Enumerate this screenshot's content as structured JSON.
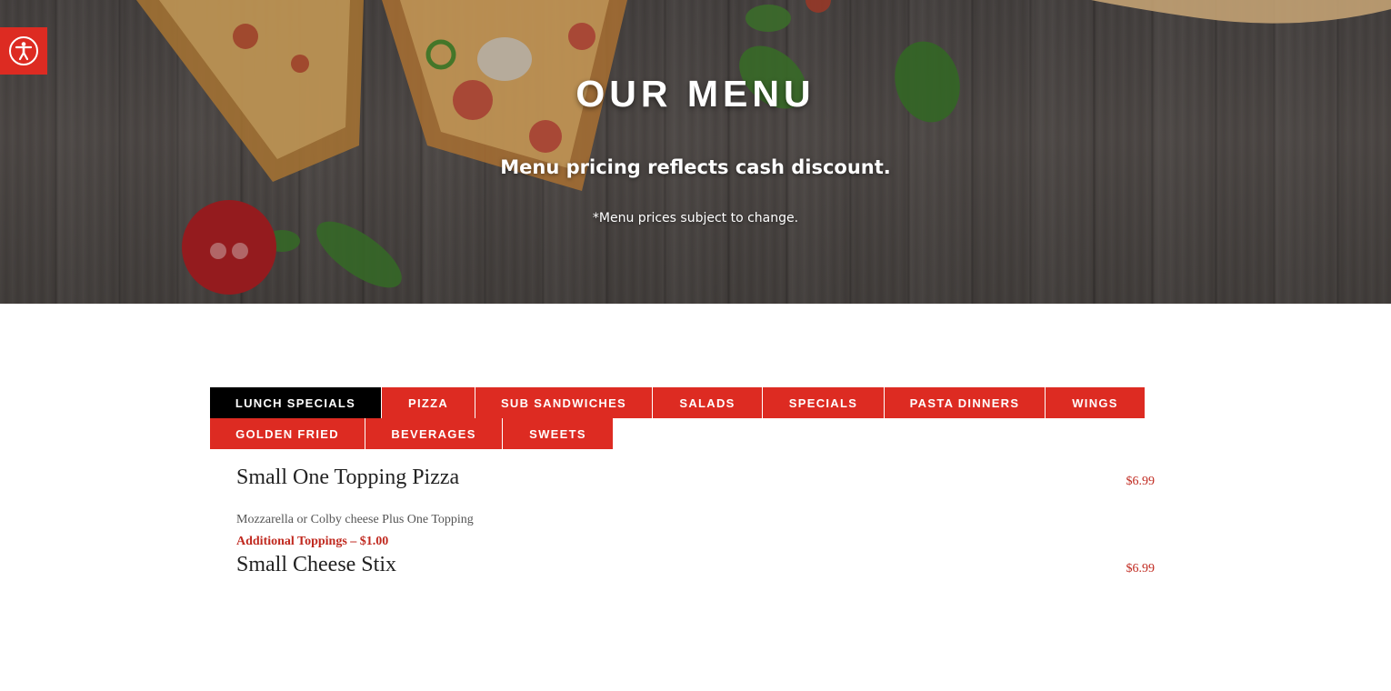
{
  "hero": {
    "title": "OUR MENU",
    "subtitle": "Menu pricing reflects cash discount.",
    "note": "*Menu prices subject to change."
  },
  "accessibility": {
    "icon": "accessibility-icon",
    "color": "#dd2b22"
  },
  "tabs": {
    "row1": [
      {
        "label": "LUNCH SPECIALS",
        "active": true
      },
      {
        "label": "PIZZA",
        "active": false
      },
      {
        "label": "SUB SANDWICHES",
        "active": false
      },
      {
        "label": "SALADS",
        "active": false
      },
      {
        "label": "SPECIALS",
        "active": false
      },
      {
        "label": "PASTA DINNERS",
        "active": false
      },
      {
        "label": "WINGS",
        "active": false
      }
    ],
    "row2": [
      {
        "label": "GOLDEN FRIED",
        "active": false
      },
      {
        "label": "BEVERAGES",
        "active": false
      },
      {
        "label": "SWEETS",
        "active": false
      }
    ],
    "active_color": "#000000",
    "color": "#dd2b22"
  },
  "menu": {
    "items": [
      {
        "name": "Small One Topping Pizza",
        "price": "$6.99",
        "description": "Mozzarella or Colby cheese Plus One Topping",
        "extra": "Additional Toppings – $1.00"
      },
      {
        "name": "Small Cheese Stix",
        "price": "$6.99"
      }
    ]
  }
}
